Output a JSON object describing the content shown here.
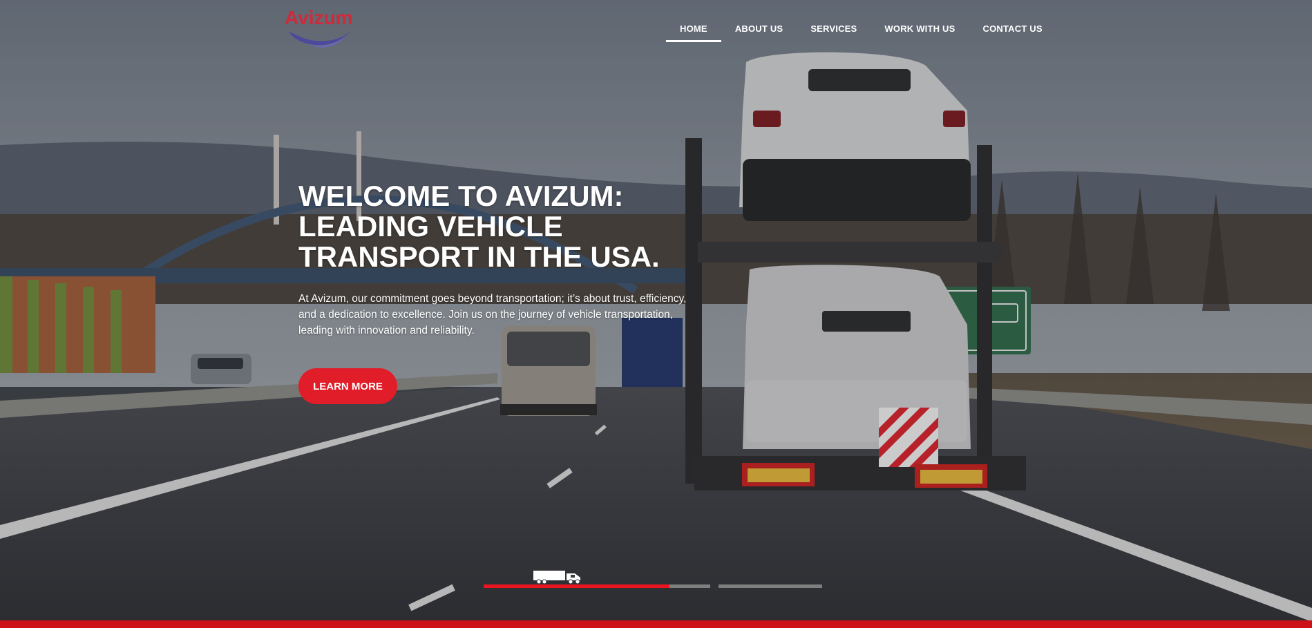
{
  "brand": {
    "logo_text": "Avizum",
    "logo_color": "#cf2a3a",
    "swoosh_color": "#4b4a9c"
  },
  "nav": {
    "items": [
      {
        "label": "HOME",
        "active": true
      },
      {
        "label": "ABOUT US",
        "active": false
      },
      {
        "label": "SERVICES",
        "active": false
      },
      {
        "label": "WORK WITH US",
        "active": false
      },
      {
        "label": "CONTACT US",
        "active": false
      }
    ]
  },
  "hero": {
    "headline": "WELCOME TO AVIZUM: LEADING VEHICLE TRANSPORT IN THE USA.",
    "description": "At Avizum, our commitment goes beyond transportation; it’s about trust, efficiency, and a dedication to excellence. Join us on the journey of vehicle transportation, leading with innovation and reliability.",
    "cta_label": "LEARN MORE",
    "background_scene": "highway with car carrier truck transporting covered cars"
  },
  "slider": {
    "slide_count": 2,
    "active_slide": 1,
    "active_progress": 0.82,
    "marker_icon": "truck-icon"
  },
  "colors": {
    "accent": "#e01d28",
    "bottom_bar": "#cc1118",
    "text": "#ffffff"
  }
}
